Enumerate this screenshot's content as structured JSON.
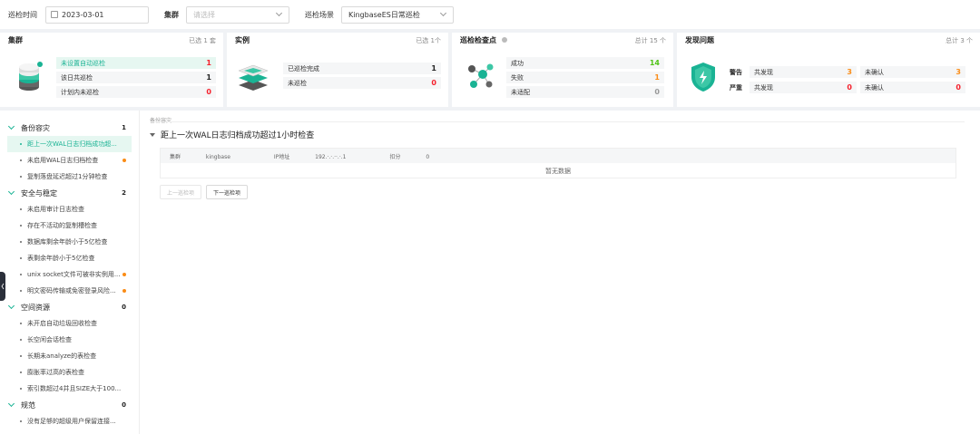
{
  "filters": {
    "time_label": "巡检时间",
    "date_value": "2023-03-01",
    "cluster_label": "集群",
    "cluster_placeholder": "请选择",
    "scene_label": "巡检场景",
    "scene_value": "KingbaseES日常巡检"
  },
  "cards": {
    "cluster": {
      "title": "集群",
      "selected": "已选 1 套",
      "rows": [
        {
          "label": "未设置自动巡检",
          "value": "1"
        },
        {
          "label": "该日共巡检",
          "value": "1"
        },
        {
          "label": "计划内未巡检",
          "value": "0"
        }
      ]
    },
    "instance": {
      "title": "实例",
      "selected": "已选 1个",
      "rows": [
        {
          "label": "已巡检完成",
          "value": "1"
        },
        {
          "label": "未巡检",
          "value": "0"
        }
      ]
    },
    "checkpoint": {
      "title": "巡检检查点",
      "total": "总计 15 个",
      "rows": [
        {
          "label": "成功",
          "value": "14"
        },
        {
          "label": "失败",
          "value": "1"
        },
        {
          "label": "未适配",
          "value": "0"
        }
      ]
    },
    "issues": {
      "title": "发现问题",
      "total": "总计 3 个",
      "warn_label": "警告",
      "severe_label": "严重",
      "found_label": "共发现",
      "unconfirmed_label": "未确认",
      "warn_found": "3",
      "warn_unconfirmed": "3",
      "severe_found": "0",
      "severe_unconfirmed": "0"
    }
  },
  "sidebar": {
    "groups": [
      {
        "label": "备份容灾",
        "count": "1",
        "items": [
          {
            "label": "距上一次WAL日志归档成功超...",
            "flag": false,
            "active": true
          },
          {
            "label": "未启用WAL日志归档检查",
            "flag": true
          },
          {
            "label": "复制落盘延迟超过1分钟检查",
            "flag": false
          }
        ]
      },
      {
        "label": "安全与稳定",
        "count": "2",
        "items": [
          {
            "label": "未启用审计日志检查",
            "flag": false
          },
          {
            "label": "存在不活动的复制槽检查",
            "flag": false
          },
          {
            "label": "数据库剩余年龄小于5亿检查",
            "flag": false
          },
          {
            "label": "表剩余年龄小于5亿检查",
            "flag": false
          },
          {
            "label": "unix socket文件可被非实例用...",
            "flag": true
          },
          {
            "label": "明文密码传输或免密登录风险...",
            "flag": true
          }
        ]
      },
      {
        "label": "空间资源",
        "count": "0",
        "items": [
          {
            "label": "未开启自动垃圾回收检查",
            "flag": false
          },
          {
            "label": "长空闲会话检查",
            "flag": false
          },
          {
            "label": "长期未analyze的表检查",
            "flag": false
          },
          {
            "label": "膨胀率过高的表检查",
            "flag": false
          },
          {
            "label": "索引数超过4并且SIZE大于100...",
            "flag": false
          }
        ]
      },
      {
        "label": "规范",
        "count": "0",
        "items": [
          {
            "label": "没有足够的超级用户保留连接...",
            "flag": false
          }
        ]
      }
    ]
  },
  "detail": {
    "crumb": "备份容灾",
    "title": "距上一次WAL日志归档成功超过1小时检查",
    "cluster_label": "集群",
    "cluster_value": "kingbase",
    "ip_label": "IP地址",
    "ip_value": "192.·.·.··.·.1",
    "score_label": "扣分",
    "score_value": "0",
    "empty_text": "暂无数据",
    "prev_btn": "上一巡检项",
    "next_btn": "下一巡检项"
  }
}
